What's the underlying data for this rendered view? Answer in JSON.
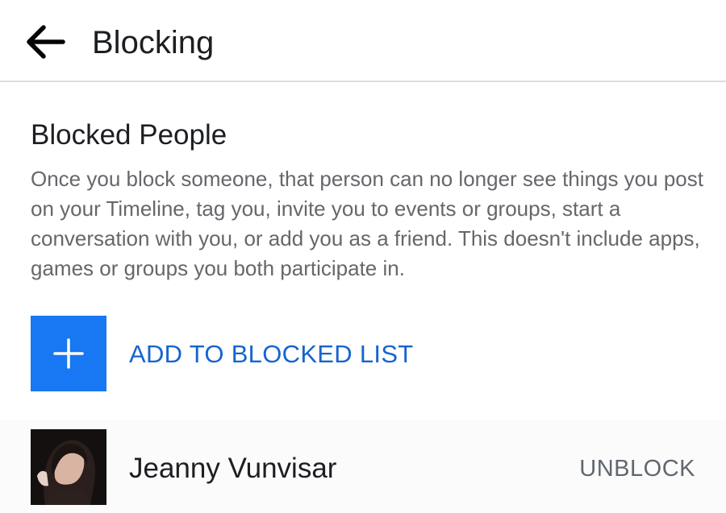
{
  "header": {
    "title": "Blocking",
    "back_icon": "arrow-left-icon"
  },
  "blocked_people": {
    "title": "Blocked People",
    "description": "Once you block someone, that person can no longer see things you post on your Timeline, tag you, invite you to events or groups, start a conversation with you, or add you as a friend. This doesn't include apps, games or groups you both participate in.",
    "add_button": {
      "icon": "plus-icon",
      "label": "ADD TO BLOCKED LIST"
    },
    "people": [
      {
        "name": "Jeanny Vunvisar",
        "action_label": "UNBLOCK"
      }
    ]
  },
  "colors": {
    "accent": "#1877f2",
    "link_text": "#1664cf",
    "primary_text": "#1c1e21",
    "secondary_text": "#65676b"
  }
}
